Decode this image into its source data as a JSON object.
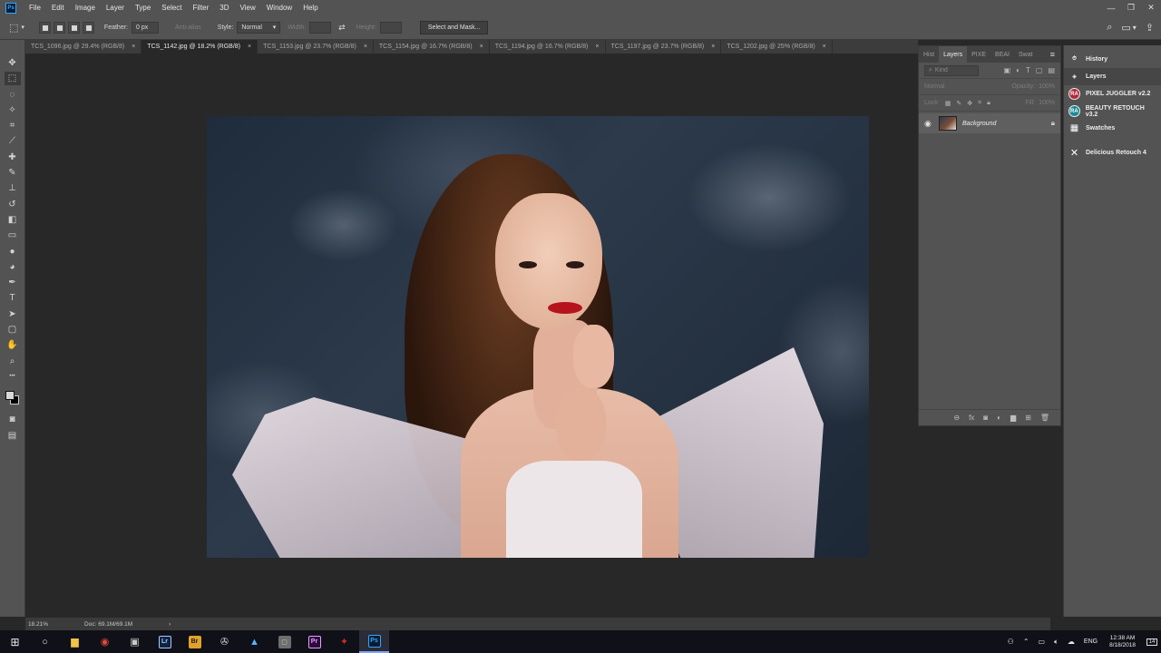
{
  "menubar": {
    "logo": "Ps",
    "items": [
      "File",
      "Edit",
      "Image",
      "Layer",
      "Type",
      "Select",
      "Filter",
      "3D",
      "View",
      "Window",
      "Help"
    ],
    "window_buttons": [
      "—",
      "❐",
      "✕"
    ]
  },
  "options": {
    "feather_label": "Feather:",
    "feather_value": "0 px",
    "anti_alias": "Anti-alias",
    "style_label": "Style:",
    "style_value": "Normal",
    "width_label": "Width:",
    "height_label": "Height:",
    "select_mask": "Select and Mask..."
  },
  "tabs": [
    {
      "label": "TCS_1096.jpg @ 29.4% (RGB/8)",
      "active": false
    },
    {
      "label": "TCS_1142.jpg @ 18.2% (RGB/8)",
      "active": true
    },
    {
      "label": "TCS_1153.jpg @ 23.7% (RGB/8)",
      "active": false
    },
    {
      "label": "TCS_1154.jpg @ 16.7% (RGB/8)",
      "active": false
    },
    {
      "label": "TCS_1194.jpg @ 16.7% (RGB/8)",
      "active": false
    },
    {
      "label": "TCS_1197.jpg @ 23.7% (RGB/8)",
      "active": false
    },
    {
      "label": "TCS_1202.jpg @ 25% (RGB/8)",
      "active": false
    }
  ],
  "tab_close": "×",
  "tools": [
    {
      "name": "move-tool",
      "glyph": "✥"
    },
    {
      "name": "marquee-tool",
      "glyph": "⬚"
    },
    {
      "name": "lasso-tool",
      "glyph": "◌"
    },
    {
      "name": "magic-wand-tool",
      "glyph": "✧"
    },
    {
      "name": "crop-tool",
      "glyph": "⌗"
    },
    {
      "name": "eyedropper-tool",
      "glyph": "⟋"
    },
    {
      "name": "healing-brush-tool",
      "glyph": "✚"
    },
    {
      "name": "brush-tool",
      "glyph": "✎"
    },
    {
      "name": "clone-stamp-tool",
      "glyph": "⊥"
    },
    {
      "name": "history-brush-tool",
      "glyph": "↺"
    },
    {
      "name": "eraser-tool",
      "glyph": "◧"
    },
    {
      "name": "gradient-tool",
      "glyph": "▭"
    },
    {
      "name": "blur-tool",
      "glyph": "●"
    },
    {
      "name": "dodge-tool",
      "glyph": "◕"
    },
    {
      "name": "pen-tool",
      "glyph": "✒"
    },
    {
      "name": "type-tool",
      "glyph": "T"
    },
    {
      "name": "path-selection-tool",
      "glyph": "➤"
    },
    {
      "name": "shape-tool",
      "glyph": "▢"
    },
    {
      "name": "hand-tool",
      "glyph": "✋"
    },
    {
      "name": "zoom-tool",
      "glyph": "⌕"
    },
    {
      "name": "more-tools",
      "glyph": "•••"
    }
  ],
  "panel": {
    "tabs": [
      "Hist",
      "Layers",
      "PIXE",
      "BEAI",
      "Swat"
    ],
    "active_tab": "Layers",
    "kind_placeholder": "Kind",
    "blend_mode": "Normal",
    "opacity_label": "Opacity:",
    "opacity_value": "100%",
    "lock_label": "Lock:",
    "fill_label": "Fill:",
    "fill_value": "100%",
    "layer_name": "Background"
  },
  "dock": {
    "history": "History",
    "layers": "Layers",
    "pixel_juggler": "PIXEL JUGGLER v2.2",
    "beauty_retouch": "BEAUTY RETOUCH v3.2",
    "swatches": "Swatches",
    "delicious": "Delicious Retouch 4",
    "ra_logo": "RA"
  },
  "status": {
    "zoom": "18.21%",
    "doc": "Doc: 69.1M/69.1M",
    "arrow": "›"
  },
  "taskbar": {
    "apps": [
      {
        "name": "file-explorer",
        "label": "▆",
        "color": "#f3c24a",
        "bg": "transparent"
      },
      {
        "name": "chrome",
        "label": "◉",
        "color": "#e04a3b",
        "bg": "transparent"
      },
      {
        "name": "app-purple",
        "label": "▣",
        "color": "#c9c9c9",
        "bg": "transparent"
      },
      {
        "name": "lightroom",
        "label": "Lr",
        "color": "#a9c8ff",
        "bg": "#10233f"
      },
      {
        "name": "bridge",
        "label": "Br",
        "color": "#1a1a1a",
        "bg": "#e0a22b"
      },
      {
        "name": "app-wheel",
        "label": "✇",
        "color": "#d4d4d4",
        "bg": "transparent"
      },
      {
        "name": "app-triangle",
        "label": "▲",
        "color": "#58b3ff",
        "bg": "transparent"
      },
      {
        "name": "app-gray",
        "label": "▢",
        "color": "#d0d0d0",
        "bg": "#6e6e6e"
      },
      {
        "name": "premiere",
        "label": "Pr",
        "color": "#e6a1ff",
        "bg": "#2b0a3d"
      },
      {
        "name": "app-red",
        "label": "✦",
        "color": "#d12a2a",
        "bg": "transparent"
      },
      {
        "name": "photoshop",
        "label": "Ps",
        "color": "#31a8ff",
        "bg": "#0b1b33"
      }
    ],
    "lang": "ENG",
    "time": "12:38 AM",
    "date": "8/18/2018",
    "notif_count": "14"
  }
}
